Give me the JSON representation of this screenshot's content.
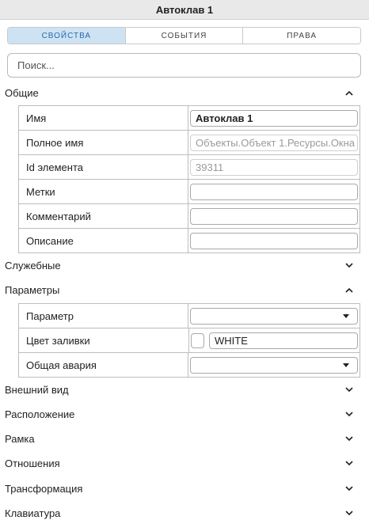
{
  "window": {
    "title": "Автоклав 1"
  },
  "tabs": [
    {
      "label": "СВОЙСТВА",
      "active": true
    },
    {
      "label": "СОБЫТИЯ",
      "active": false
    },
    {
      "label": "ПРАВА",
      "active": false
    }
  ],
  "search": {
    "placeholder": "Поиск..."
  },
  "sections": {
    "general": {
      "title": "Общие",
      "expanded": true,
      "rows": [
        {
          "label": "Имя",
          "value": "Автоклав 1"
        },
        {
          "label": "Полное имя",
          "value": "Объекты.Объект 1.Ресурсы.Окна"
        },
        {
          "label": "Id элемента",
          "value": "39311"
        },
        {
          "label": "Метки",
          "value": ""
        },
        {
          "label": "Комментарий",
          "value": ""
        },
        {
          "label": "Описание",
          "value": ""
        }
      ]
    },
    "service": {
      "title": "Служебные",
      "expanded": false
    },
    "params": {
      "title": "Параметры",
      "expanded": true,
      "rows": [
        {
          "label": "Параметр",
          "value": ""
        },
        {
          "label": "Цвет заливки",
          "value": "WHITE",
          "color": "#ffffff"
        },
        {
          "label": "Общая авария",
          "value": ""
        }
      ]
    },
    "appearance": {
      "title": "Внешний вид",
      "expanded": false
    },
    "layout": {
      "title": "Расположение",
      "expanded": false
    },
    "frame": {
      "title": "Рамка",
      "expanded": false
    },
    "relations": {
      "title": "Отношения",
      "expanded": false
    },
    "transform": {
      "title": "Трансформация",
      "expanded": false
    },
    "keyboard": {
      "title": "Клавиатура",
      "expanded": false
    }
  },
  "colors": {
    "active_tab_bg": "#cde3f4",
    "active_tab_text": "#2a6aa8",
    "border": "#bdbdbd"
  },
  "icons": {
    "expanded": "chevron-up-icon",
    "collapsed": "chevron-down-icon",
    "dropdown": "caret-down-icon"
  }
}
